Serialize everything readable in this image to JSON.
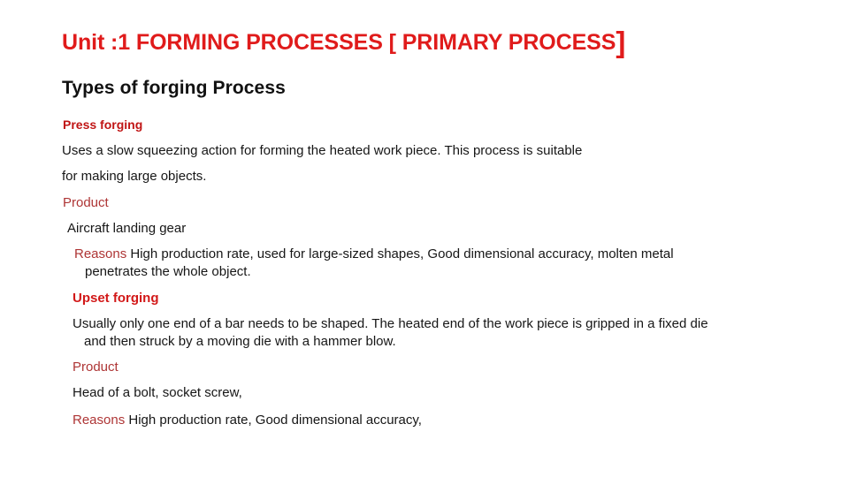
{
  "slide": {
    "background_color": "#ffffff",
    "title": {
      "main": "Unit :1 FORMING  PROCESSES [ PRIMARY PROCESS",
      "bracket_close": "]",
      "color": "#E01B1B"
    },
    "heading": {
      "text": "Types of  forging Process",
      "color": "#111111"
    },
    "sections": [
      {
        "subhead": "Press forging",
        "subhead_color": "#C01515",
        "description_line_1": "Uses a slow squeezing action for forming the heated work piece. This process is suitable",
        "description_line_2": "for making large objects.",
        "product_label": "Product",
        "product_value": "Aircraft landing gear",
        "reasons_label": "Reasons",
        "reasons_line_1": "High production rate, used for large-sized shapes, Good dimensional accuracy, molten metal",
        "reasons_line_2": "penetrates the whole object."
      },
      {
        "subhead": "Upset forging",
        "subhead_color": "#D21818",
        "description_line_1": "Usually only one end of a bar needs to be shaped. The heated end of the work piece is gripped in a fixed die",
        "description_line_2": "and then struck by a moving die with a hammer blow.",
        "product_label": "Product",
        "product_value": "Head of a bolt, socket screw,",
        "reasons_label": "Reasons",
        "reasons_line_1": "High production rate,  Good dimensional accuracy,"
      }
    ],
    "label_color": "#AE3535",
    "body_text_color": "#161616"
  }
}
